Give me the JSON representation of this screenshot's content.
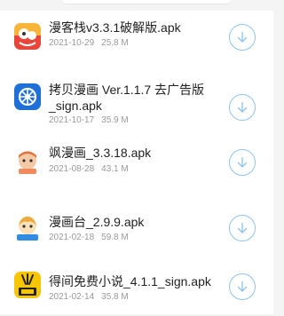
{
  "files": [
    {
      "name": "漫客栈v3.3.1破解版.apk",
      "date": "2021-10-29",
      "size": "25.8 M",
      "icon": "manke-app-icon",
      "icon_color": "#f5a623"
    },
    {
      "name": "拷贝漫画 Ver.1.1.7 去广告版\n_sign.apk",
      "date": "2021-10-17",
      "size": "35.9 M",
      "icon": "kaobei-app-icon",
      "icon_color": "#1e6fd8"
    },
    {
      "name": "飒漫画_3.3.18.apk",
      "date": "2021-08-28",
      "size": "43.1 M",
      "icon": "sa-manhua-app-icon",
      "icon_color": "#f08a5d"
    },
    {
      "name": "漫画台_2.9.9.apk",
      "date": "2021-02-18",
      "size": "59.8 M",
      "icon": "manhuatai-app-icon",
      "icon_color": "#2f8de4"
    },
    {
      "name": "得间免费小说_4.1.1_sign.apk",
      "date": "2021-02-14",
      "size": "35.8 M",
      "icon": "dejian-app-icon",
      "icon_color": "#f7c600"
    }
  ],
  "accent_color": "#8ec3ee"
}
